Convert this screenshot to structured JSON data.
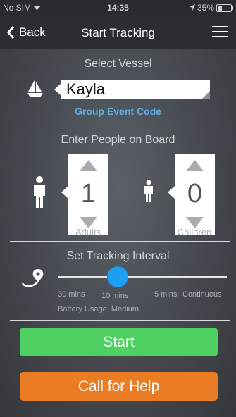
{
  "status_bar": {
    "carrier": "No SIM",
    "time": "14:35",
    "battery_text": "35%",
    "battery_level": 0.35
  },
  "nav": {
    "back_label": "Back",
    "title": "Start Tracking",
    "menu_icon": "hamburger-menu-icon"
  },
  "vessel": {
    "section_title": "Select Vessel",
    "selected": "Kayla",
    "group_event_link": "Group Event Code",
    "icon": "sailboat-icon"
  },
  "people": {
    "section_title": "Enter People on Board",
    "adults": {
      "value": "1",
      "label": "Adults",
      "icon": "adult-person-icon"
    },
    "children": {
      "value": "0",
      "label": "Children",
      "icon": "child-person-icon"
    }
  },
  "tracking": {
    "section_title": "Set Tracking Interval",
    "options": [
      "30 mins",
      "10 mins",
      "5 mins",
      "Continuous"
    ],
    "selected_index": 1,
    "battery_usage": "Battery Usage: Medium",
    "icon": "location-pin-path-icon"
  },
  "actions": {
    "start_label": "Start",
    "help_label": "Call for Help",
    "colors": {
      "start": "#4fd162",
      "help": "#ea7d23",
      "link": "#5aaee4",
      "slider": "#1ea0f2"
    }
  }
}
